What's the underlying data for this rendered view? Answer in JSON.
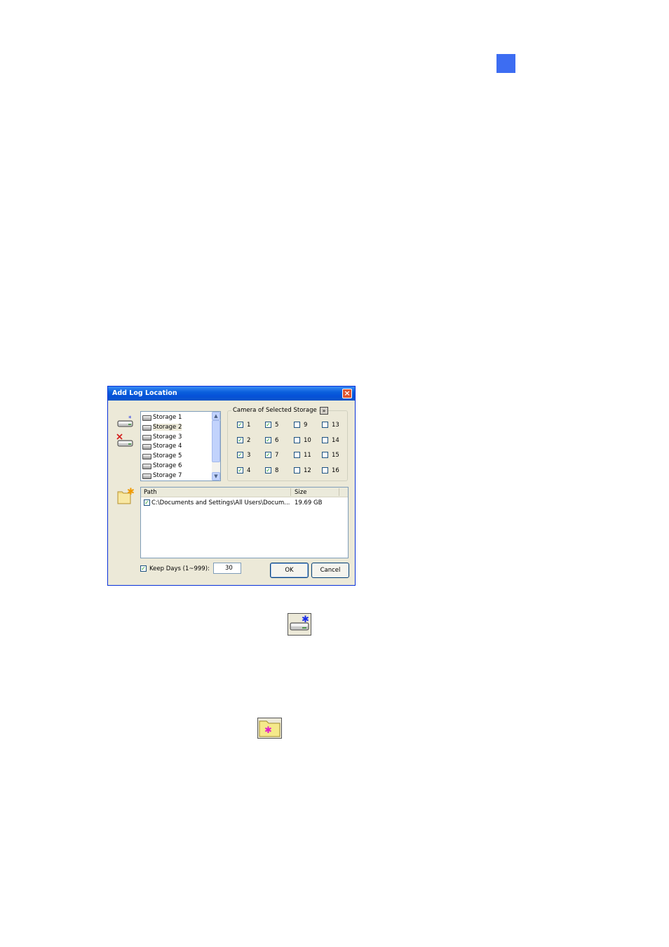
{
  "page": {
    "marker_color": "#3d6df2"
  },
  "dialog": {
    "title": "Add Log Location",
    "storage_list": [
      {
        "label": "Storage 1",
        "selected": false
      },
      {
        "label": "Storage 2",
        "selected": true
      },
      {
        "label": "Storage 3",
        "selected": false
      },
      {
        "label": "Storage 4",
        "selected": false
      },
      {
        "label": "Storage 5",
        "selected": false
      },
      {
        "label": "Storage 6",
        "selected": false
      },
      {
        "label": "Storage 7",
        "selected": false
      }
    ],
    "camera_group": {
      "title": "Camera of Selected Storage",
      "more_label": "»",
      "cameras": [
        {
          "num": "1",
          "checked": true
        },
        {
          "num": "2",
          "checked": true
        },
        {
          "num": "3",
          "checked": true
        },
        {
          "num": "4",
          "checked": true
        },
        {
          "num": "5",
          "checked": true
        },
        {
          "num": "6",
          "checked": true
        },
        {
          "num": "7",
          "checked": true
        },
        {
          "num": "8",
          "checked": true
        },
        {
          "num": "9",
          "checked": false
        },
        {
          "num": "10",
          "checked": false
        },
        {
          "num": "11",
          "checked": false
        },
        {
          "num": "12",
          "checked": false
        },
        {
          "num": "13",
          "checked": false
        },
        {
          "num": "14",
          "checked": false
        },
        {
          "num": "15",
          "checked": false
        },
        {
          "num": "16",
          "checked": false
        }
      ]
    },
    "table": {
      "headers": {
        "path": "Path",
        "size": "Size"
      },
      "rows": [
        {
          "checked": true,
          "path": "C:\\Documents and Settings\\All Users\\Docum...",
          "size": "19.69 GB"
        }
      ]
    },
    "keep_days": {
      "label": "Keep Days (1~999):",
      "checked": true,
      "value": "30"
    },
    "ok_label": "OK",
    "cancel_label": "Cancel",
    "close_label": "×"
  },
  "checkmark": "✓",
  "icons": [
    "add-storage-icon",
    "delete-storage-icon",
    "add-folder-icon"
  ]
}
